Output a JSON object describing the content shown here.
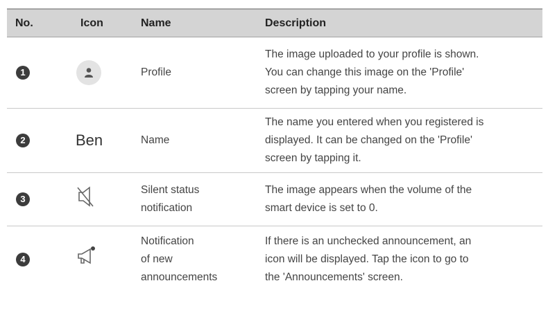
{
  "header": {
    "no": "No.",
    "icon": "Icon",
    "name": "Name",
    "description": "Description"
  },
  "rows": [
    {
      "number": "1",
      "icon": "person-icon",
      "name": "Profile",
      "desc": [
        "The image uploaded to your profile is shown.",
        "You can change this image on the 'Profile'",
        "screen by tapping your name."
      ]
    },
    {
      "number": "2",
      "icon_text": "Ben",
      "name": "Name",
      "desc": [
        "The name you entered when you registered is",
        "displayed. It can be changed on the 'Profile'",
        "screen by tapping it."
      ]
    },
    {
      "number": "3",
      "icon": "speaker-muted-icon",
      "name": [
        "Silent status",
        "notification"
      ],
      "desc": [
        "The image appears when the volume of the",
        "smart device is set to 0."
      ]
    },
    {
      "number": "4",
      "icon": "megaphone-icon",
      "name": [
        "Notification",
        "of new",
        "announcements"
      ],
      "desc": [
        "If there is an unchecked announcement, an",
        "icon will be displayed. Tap the icon to go to",
        "the 'Announcements' screen."
      ]
    }
  ]
}
